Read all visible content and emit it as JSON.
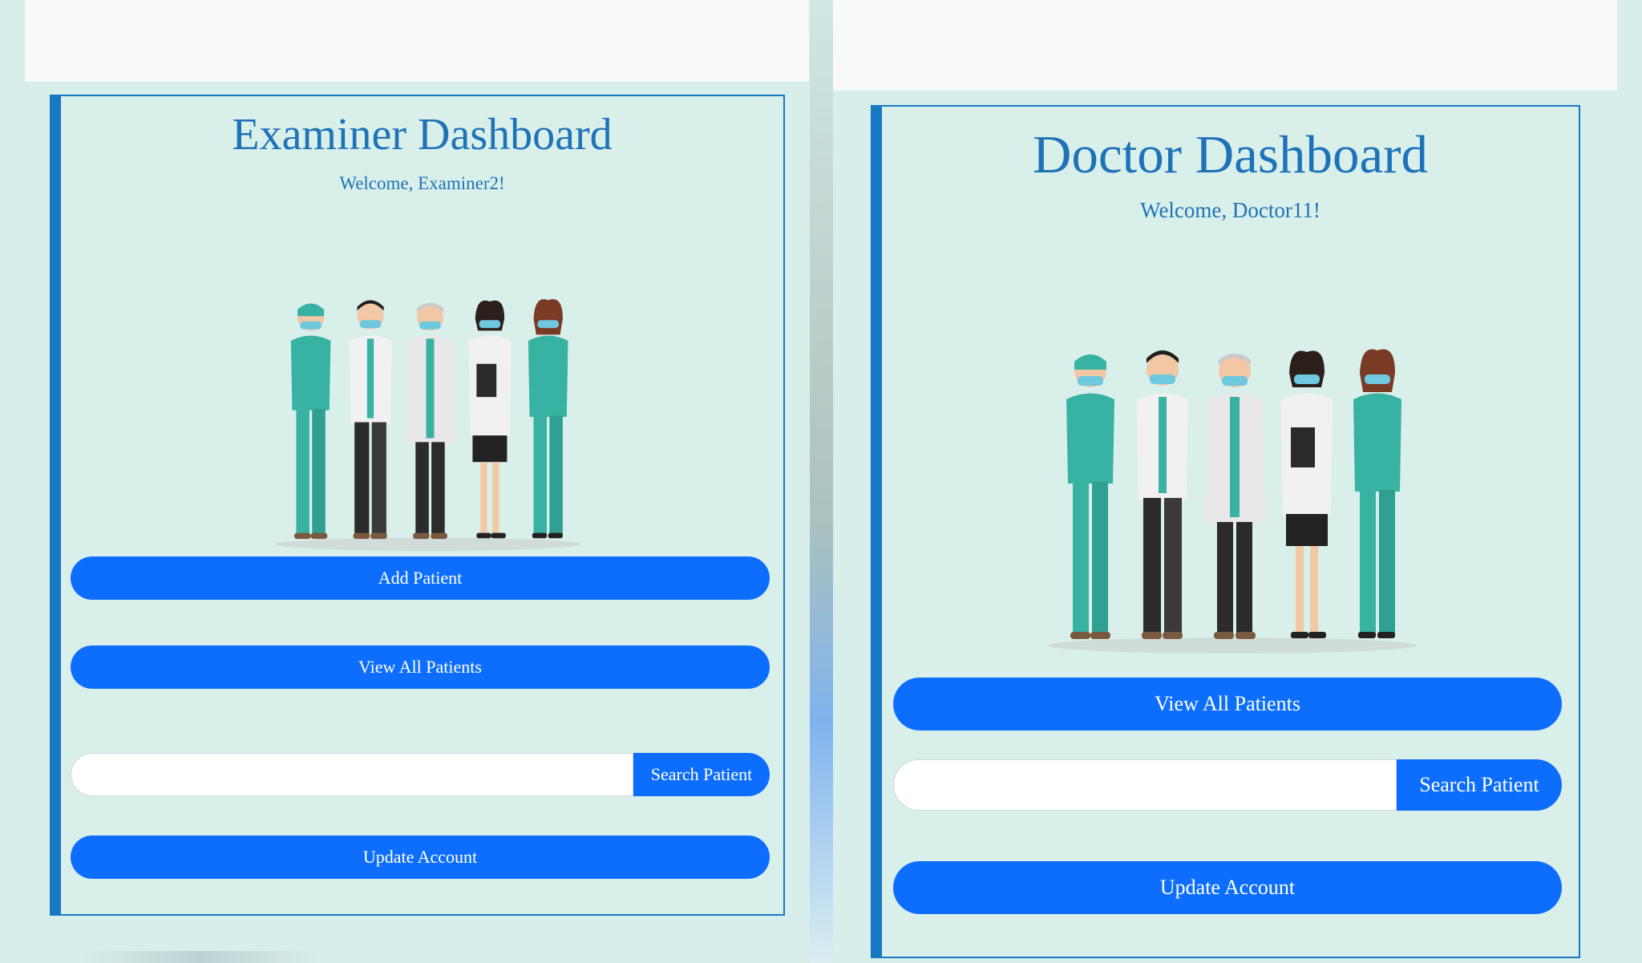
{
  "examiner": {
    "title": "Examiner Dashboard",
    "welcome": "Welcome, Examiner2!",
    "buttons": {
      "add_patient": "Add Patient",
      "view_all": "View All Patients",
      "search": "Search Patient",
      "update": "Update Account"
    },
    "search_value": ""
  },
  "doctor": {
    "title": "Doctor Dashboard",
    "welcome": "Welcome, Doctor11!",
    "buttons": {
      "view_all": "View All Patients",
      "search": "Search Patient",
      "update": "Update Account"
    },
    "search_value": ""
  },
  "colors": {
    "accent": "#1779c4",
    "button": "#0d6efd",
    "background": "#d9efea",
    "title": "#1e73b8"
  },
  "illustration": "medical-staff-group-illustration"
}
